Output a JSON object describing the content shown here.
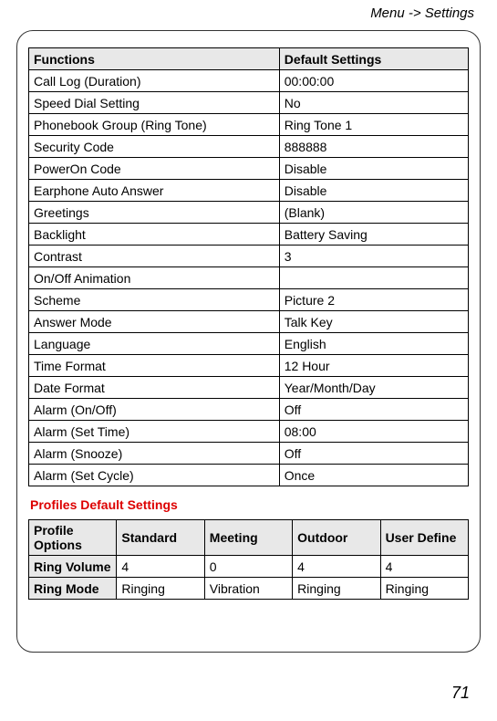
{
  "header": {
    "breadcrumb": "Menu -> Settings"
  },
  "settings_table": {
    "headers": {
      "col1": "Functions",
      "col2": "Default Settings"
    },
    "rows": [
      {
        "fn": "Call Log (Duration)",
        "val": "00:00:00"
      },
      {
        "fn": "Speed Dial Setting",
        "val": "No"
      },
      {
        "fn": "Phonebook Group (Ring Tone)",
        "val": "Ring Tone 1"
      },
      {
        "fn": "Security Code",
        "val": "888888"
      },
      {
        "fn": "PowerOn Code",
        "val": "Disable"
      },
      {
        "fn": "Earphone Auto Answer",
        "val": "Disable"
      },
      {
        "fn": "Greetings",
        "val": "(Blank)"
      },
      {
        "fn": "Backlight",
        "val": "Battery Saving"
      },
      {
        "fn": "Contrast",
        "val": "3"
      },
      {
        "fn": "On/Off Animation",
        "val": ""
      },
      {
        "fn": "Scheme",
        "val": "Picture 2"
      },
      {
        "fn": "Answer Mode",
        "val": "Talk Key"
      },
      {
        "fn": "Language",
        "val": "English"
      },
      {
        "fn": "Time Format",
        "val": "12 Hour"
      },
      {
        "fn": "Date Format",
        "val": "Year/Month/Day"
      },
      {
        "fn": "Alarm (On/Off)",
        "val": "Off"
      },
      {
        "fn": "Alarm (Set Time)",
        "val": "08:00"
      },
      {
        "fn": "Alarm (Snooze)",
        "val": "Off"
      },
      {
        "fn": "Alarm (Set Cycle)",
        "val": "Once"
      }
    ]
  },
  "profiles_section": {
    "title": "Profiles Default Settings"
  },
  "profiles_table": {
    "headers": {
      "col1": "Profile Options",
      "col2": "Standard",
      "col3": "Meeting",
      "col4": "Outdoor",
      "col5": "User Define"
    },
    "rows": [
      {
        "opt": "Ring Volume",
        "c1": "4",
        "c2": "0",
        "c3": "4",
        "c4": "4"
      },
      {
        "opt": "Ring Mode",
        "c1": "Ringing",
        "c2": "Vibration",
        "c3": "Ringing",
        "c4": "Ringing"
      }
    ]
  },
  "page_number": "71"
}
